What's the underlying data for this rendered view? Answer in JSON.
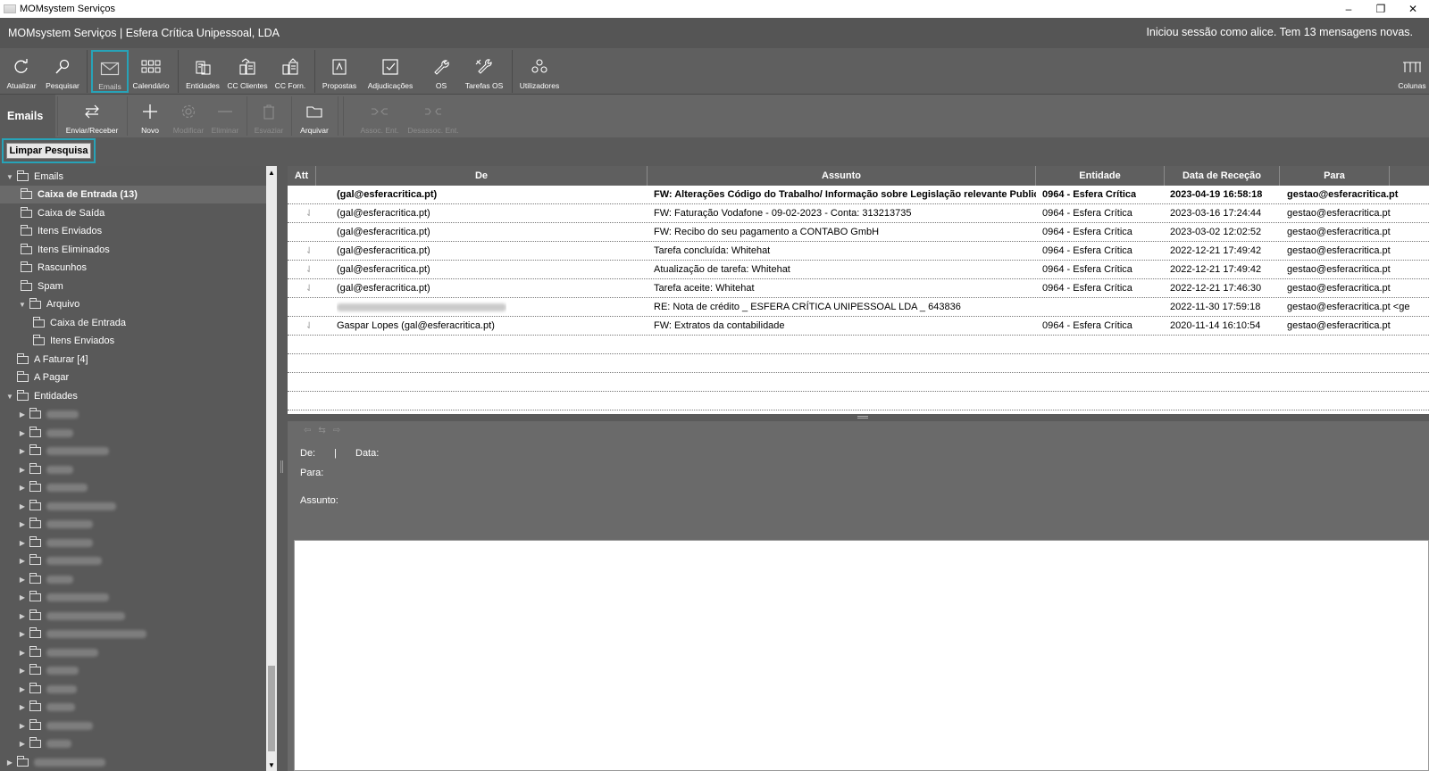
{
  "window": {
    "title": "MOMsystem Serviços",
    "minimize": "–",
    "restore": "❐",
    "close": "✕"
  },
  "header": {
    "app_title": "MOMsystem Serviços | Esfera Crítica Unipessoal, LDA",
    "session_text": "Iniciou sessão como alice.  Tem 13 mensagens novas."
  },
  "toolbar": {
    "buttons": [
      {
        "label": "Atualizar",
        "icon": "refresh-icon"
      },
      {
        "label": "Pesquisar",
        "icon": "search-icon"
      },
      {
        "label": "Emails",
        "icon": "mail-icon"
      },
      {
        "label": "Calendário",
        "icon": "calendar-grid-icon"
      },
      {
        "label": "Entidades",
        "icon": "entities-icon"
      },
      {
        "label": "CC Clientes",
        "icon": "clients-account-icon"
      },
      {
        "label": "CC Forn.",
        "icon": "suppliers-account-icon"
      },
      {
        "label": "Propostas",
        "icon": "proposal-icon"
      },
      {
        "label": "Adjudicações",
        "icon": "award-check-icon"
      },
      {
        "label": "OS",
        "icon": "wrench-icon"
      },
      {
        "label": "Tarefas OS",
        "icon": "tools-icon"
      },
      {
        "label": "Utilizadores",
        "icon": "users-icon"
      },
      {
        "label": "Colunas",
        "icon": "columns-icon"
      }
    ]
  },
  "subtoolbar": {
    "section": "Emails",
    "buttons": [
      {
        "label": "Enviar/Receber",
        "icon": "send-receive-icon"
      },
      {
        "label": "Novo",
        "icon": "plus-icon"
      },
      {
        "label": "Modificar",
        "icon": "gear-icon"
      },
      {
        "label": "Eliminar",
        "icon": "minus-icon"
      },
      {
        "label": "Esvaziar",
        "icon": "trash-icon"
      },
      {
        "label": "Arquivar",
        "icon": "folder-icon"
      },
      {
        "label": "Assoc. Ent.",
        "icon": "link-icon"
      },
      {
        "label": "Desassoc. Ent.",
        "icon": "unlink-icon"
      }
    ]
  },
  "search": {
    "clear_label": "Limpar Pesquisa"
  },
  "tree": {
    "nodes": [
      {
        "label": "Emails"
      },
      {
        "label": "Caixa de Entrada (13)"
      },
      {
        "label": "Caixa de Saída"
      },
      {
        "label": "Itens Enviados"
      },
      {
        "label": "Itens Eliminados"
      },
      {
        "label": "Rascunhos"
      },
      {
        "label": "Spam"
      },
      {
        "label": "Arquivo"
      },
      {
        "label": "Caixa de Entrada"
      },
      {
        "label": "Itens Enviados"
      },
      {
        "label": "A Faturar [4]"
      },
      {
        "label": "A Pagar"
      },
      {
        "label": "Entidades"
      }
    ]
  },
  "grid": {
    "columns": [
      "Att",
      "De",
      "Assunto",
      "Entidade",
      "Data de Receção",
      "Para"
    ],
    "rows": [
      {
        "de": "(gal@esferacritica.pt)",
        "assunto": "FW: Alterações Código do Trabalho/ Informação sobre Legislação relevante Publicada no Diá",
        "entidade": "0964 - Esfera Crítica",
        "data": "2023-04-19 16:58:18",
        "para": "gestao@esferacritica.pt"
      },
      {
        "de": "(gal@esferacritica.pt)",
        "assunto": "FW: Faturação Vodafone - 09-02-2023 - Conta: 313213735",
        "entidade": "0964 - Esfera Crítica",
        "data": "2023-03-16 17:24:44",
        "para": "gestao@esferacritica.pt"
      },
      {
        "de": "(gal@esferacritica.pt)",
        "assunto": "FW: Recibo do seu pagamento a CONTABO GmbH",
        "entidade": "0964 - Esfera Crítica",
        "data": "2023-03-02 12:02:52",
        "para": "gestao@esferacritica.pt"
      },
      {
        "de": "(gal@esferacritica.pt)",
        "assunto": "Tarefa concluída: Whitehat",
        "entidade": "0964 - Esfera Crítica",
        "data": "2022-12-21 17:49:42",
        "para": "gestao@esferacritica.pt"
      },
      {
        "de": "(gal@esferacritica.pt)",
        "assunto": "Atualização de tarefa: Whitehat",
        "entidade": "0964 - Esfera Crítica",
        "data": "2022-12-21 17:49:42",
        "para": "gestao@esferacritica.pt"
      },
      {
        "de": "(gal@esferacritica.pt)",
        "assunto": "Tarefa aceite: Whitehat",
        "entidade": "0964 - Esfera Crítica",
        "data": "2022-12-21 17:46:30",
        "para": "gestao@esferacritica.pt"
      },
      {
        "de": "",
        "assunto": "RE: Nota de crédito _ ESFERA CRÍTICA UNIPESSOAL LDA _ 643836",
        "entidade": "",
        "data": "2022-11-30 17:59:18",
        "para": "gestao@esferacritica.pt <ge"
      },
      {
        "de": "Gaspar Lopes (gal@esferacritica.pt)",
        "assunto": "FW: Extratos da contabilidade",
        "entidade": "0964 - Esfera Crítica",
        "data": "2020-11-14 16:10:54",
        "para": "gestao@esferacritica.pt"
      }
    ]
  },
  "preview": {
    "de_label": "De:",
    "sep": "|",
    "data_label": "Data:",
    "para_label": "Para:",
    "assunto_label": "Assunto:",
    "nav": [
      "⇦",
      "⇆",
      "⇨"
    ]
  },
  "colors": {
    "accent": "#27a3b8",
    "toolbar": "#5f5f5f",
    "panel": "#595959"
  }
}
